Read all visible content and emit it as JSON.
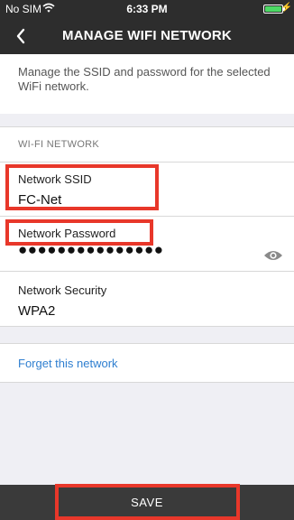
{
  "status_bar": {
    "carrier": "No SIM",
    "time": "6:33 PM",
    "icons": [
      "wifi-icon",
      "battery-icon",
      "charging-bolt-icon"
    ],
    "battery_color": "#4cd964"
  },
  "nav_bar": {
    "title": "MANAGE WIFI NETWORK",
    "back_icon": "chevron-left-icon",
    "background": "#2d2d2d"
  },
  "description": "Manage the SSID and password for the selected WiFi network.",
  "section_header": "WI-FI NETWORK",
  "fields": {
    "ssid": {
      "label": "Network SSID",
      "value": "FC-Net"
    },
    "password": {
      "label": "Network Password",
      "value": "●●●●●●●●●●●●●●●",
      "reveal_icon": "eye-icon"
    },
    "security": {
      "label": "Network Security",
      "value": "WPA2"
    }
  },
  "forget_link": "Forget this network",
  "save_button": "SAVE",
  "colors": {
    "highlight": "#e8372a",
    "link": "#2f7fd0",
    "footer": "#3a3a3a"
  }
}
